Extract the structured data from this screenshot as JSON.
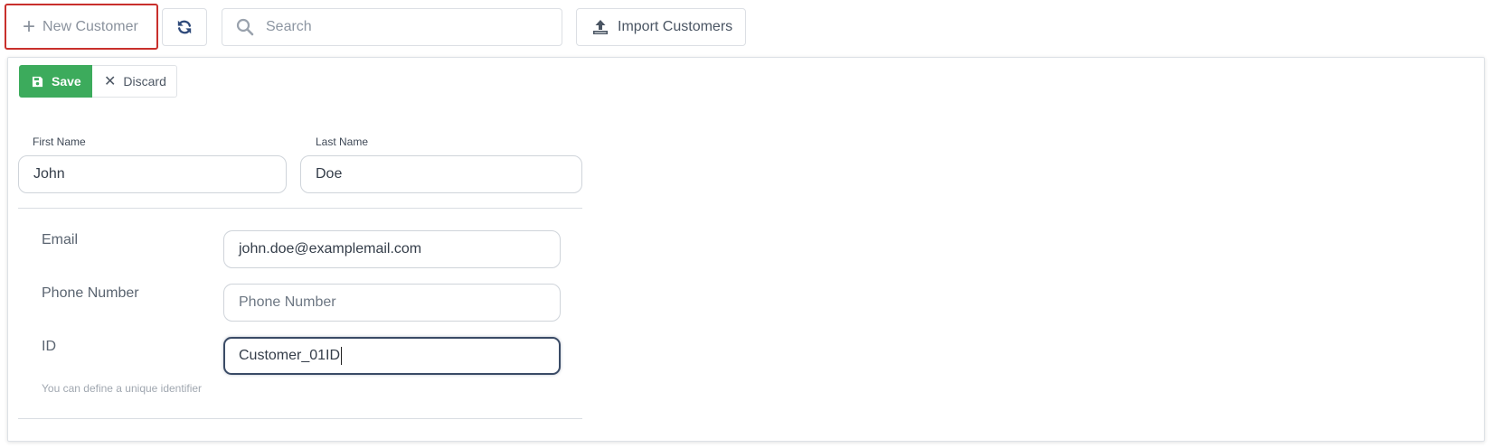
{
  "toolbar": {
    "new_customer_label": "New Customer",
    "search_placeholder": "Search",
    "import_label": "Import Customers",
    "icons": {
      "new": "plus-icon",
      "refresh": "refresh-icon",
      "search": "search-icon",
      "import": "upload-icon"
    }
  },
  "form_actions": {
    "save_label": "Save",
    "discard_label": "Discard",
    "save_color": "#3cab5c"
  },
  "form": {
    "first_name": {
      "label": "First Name",
      "value": "John"
    },
    "last_name": {
      "label": "Last Name",
      "value": "Doe"
    },
    "email": {
      "label": "Email",
      "value": "john.doe@examplemail.com"
    },
    "phone": {
      "label": "Phone Number",
      "value": "",
      "placeholder": "Phone Number"
    },
    "id": {
      "label": "ID",
      "value": "Customer_01ID",
      "hint": "You can define a unique identifier"
    }
  }
}
